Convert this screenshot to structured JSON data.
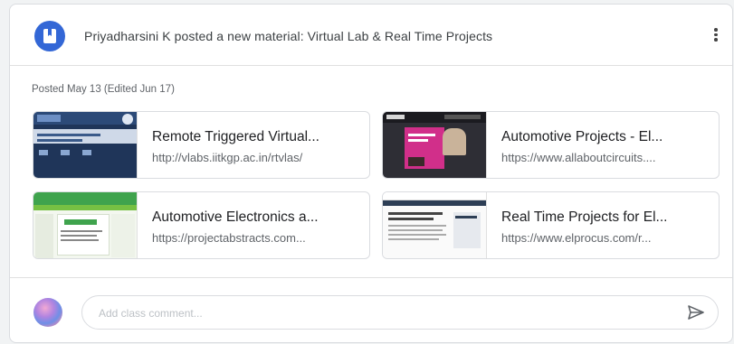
{
  "post": {
    "author": "Priyadharsini K",
    "title": "Priyadharsini K posted a new material: Virtual Lab & Real Time Projects",
    "posted": "Posted May 13 (Edited Jun 17)"
  },
  "materials": [
    {
      "title": "Remote Triggered Virtual...",
      "url": "http://vlabs.iitkgp.ac.in/rtvlas/",
      "thumb_text": "Welcome to Remote Triggered Virtual Lab"
    },
    {
      "title": "Automotive Projects - El...",
      "url": "https://www.allaboutcircuits....",
      "thumb_text": "AllAboutCircuits"
    },
    {
      "title": "Automotive Electronics a...",
      "url": "https://projectabstracts.com...",
      "thumb_text": "Automotive Electronics"
    },
    {
      "title": "Real Time Projects for El...",
      "url": "https://www.elprocus.com/r...",
      "thumb_text": "Latest Real Time Projects for Engineering Students"
    }
  ],
  "comment": {
    "placeholder": "Add class comment..."
  },
  "icons": {
    "doc": "material-icon",
    "menu": "more-vert-icon",
    "send": "send-icon"
  },
  "colors": {
    "accent": "#3367d6"
  }
}
